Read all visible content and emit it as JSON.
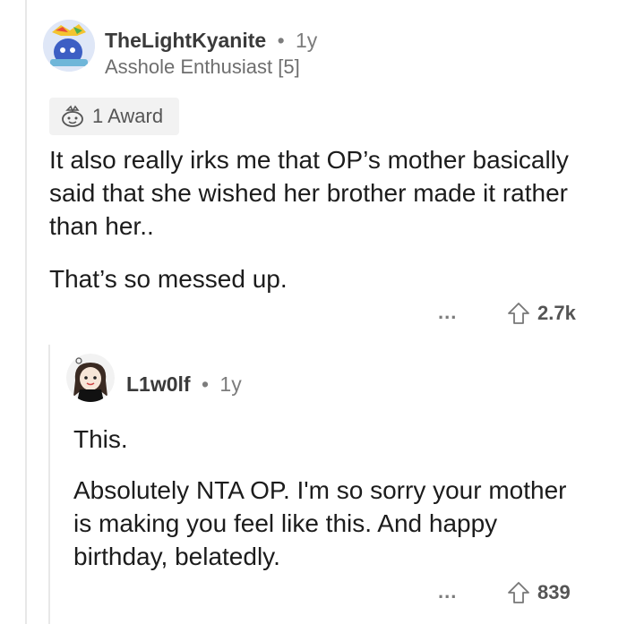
{
  "comment": {
    "username": "TheLightKyanite",
    "separator": "•",
    "age": "1y",
    "flair": "Asshole Enthusiast [5]",
    "award_label": "1 Award",
    "paragraphs": [
      "It also really irks me that OP’s mother basically said that she wished her brother made it rather than her..",
      "That’s so messed up."
    ],
    "more": "...",
    "score": "2.7k"
  },
  "reply": {
    "username": "L1w0lf",
    "separator": "•",
    "age": "1y",
    "paragraphs": [
      "This.",
      "Absolutely NTA OP. I'm so sorry your mother is making you feel like this. And happy birthday, belatedly."
    ],
    "more": "...",
    "score": "839"
  },
  "colors": {
    "avatar_blue": "#4a6fd0",
    "text": "#1c1c1c",
    "meta": "#7c7c7c"
  }
}
